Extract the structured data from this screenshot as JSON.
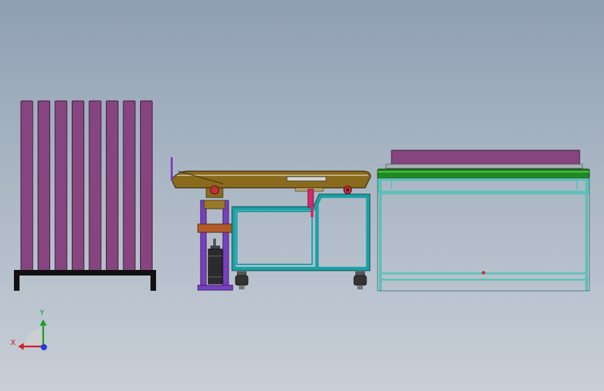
{
  "viewport": {
    "background_top": "#8f9fb4",
    "background_bottom": "#c8cfd8"
  },
  "components": {
    "rack": {
      "name": "panel-storage-rack",
      "board_count": 8,
      "board_color": "#86457f",
      "base_color": "#111111"
    },
    "cart": {
      "name": "tilting-transfer-cart",
      "bed_color": "#8a6a1c",
      "frame_color": "#1aa0a6",
      "lift_frame_color": "#7a3fc0",
      "cylinder_color": "#2b2b2b",
      "wheel_color": "#333333"
    },
    "conveyor": {
      "name": "roller-conveyor-table",
      "belt_color": "#1f8a1f",
      "load_color": "#86457f",
      "frame_color": "#5fc0b8"
    }
  },
  "triad": {
    "x_label": "X",
    "y_label": "Y",
    "x_color": "#d0202a",
    "y_color": "#1aa02a",
    "z_color": "#2040d0"
  }
}
